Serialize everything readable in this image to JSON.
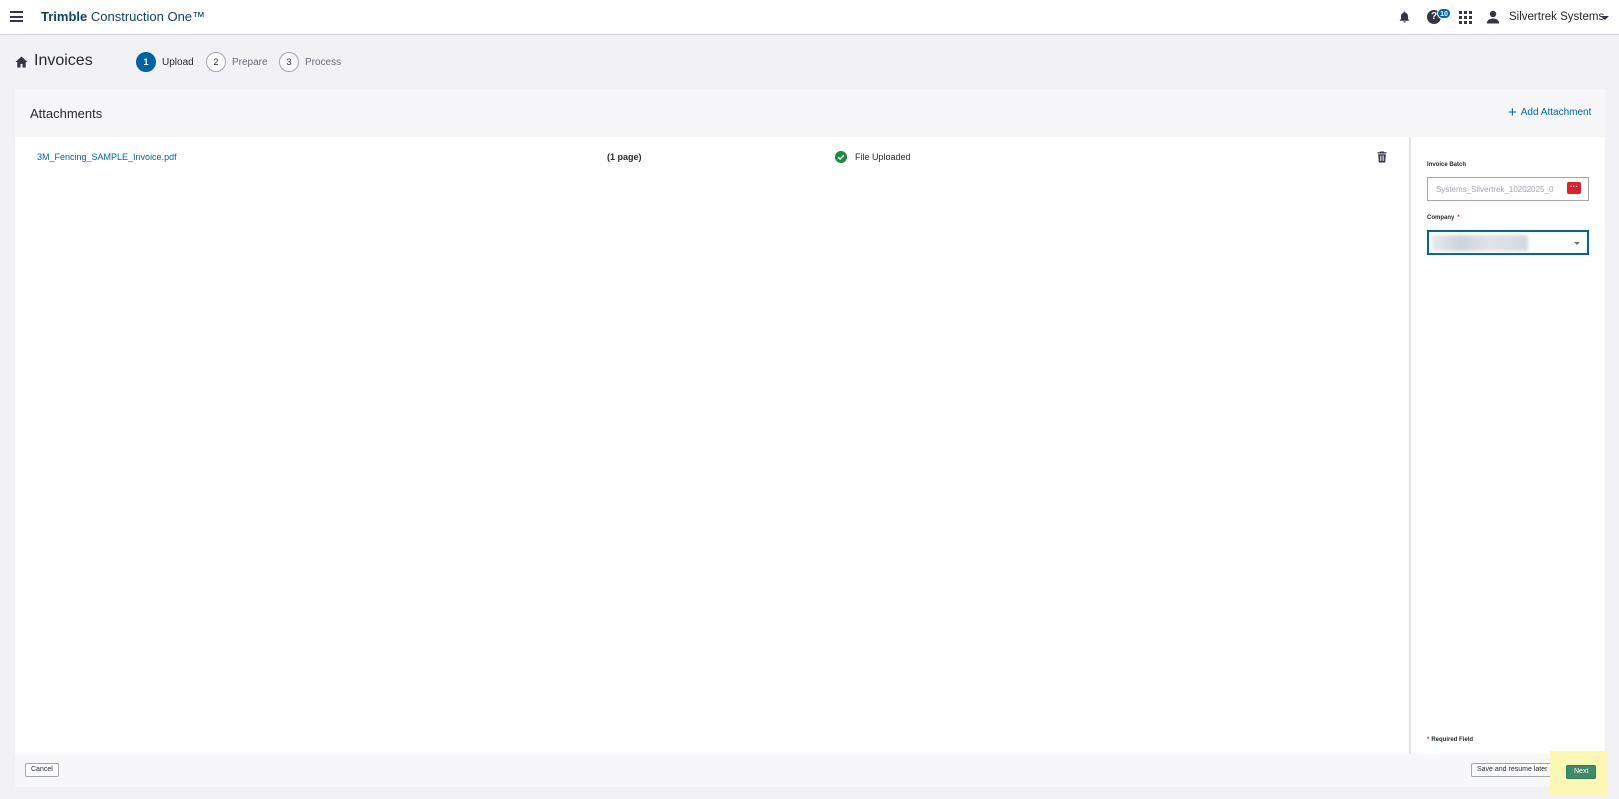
{
  "topbar": {
    "brand_bold": "Trimble",
    "brand_rest": " Construction One™",
    "help_badge": "10",
    "user_name": "Silvertrek Systems"
  },
  "header": {
    "title": "Invoices",
    "steps": [
      {
        "num": "1",
        "label": "Upload",
        "active": true
      },
      {
        "num": "2",
        "label": "Prepare",
        "active": false
      },
      {
        "num": "3",
        "label": "Process",
        "active": false
      }
    ]
  },
  "attachments": {
    "title": "Attachments",
    "add_label": "Add Attachment",
    "files": [
      {
        "name": "3M_Fencing_SAMPLE_Invoice.pdf",
        "pages": "(1 page)",
        "status": "File Uploaded"
      }
    ]
  },
  "side_panel": {
    "batch_label": "Invoice Batch",
    "batch_value": "Systems_Silvertrek_10202025_0",
    "company_label": "Company",
    "required_note": "Required Field"
  },
  "footer": {
    "cancel": "Cancel",
    "save": "Save and resume later",
    "next": "Next"
  },
  "colors": {
    "brand_blue": "#0e416c",
    "link_blue": "#0063a3",
    "success_green": "#1e8a44",
    "next_green": "#3f8a6a",
    "required_red": "#da212c"
  }
}
